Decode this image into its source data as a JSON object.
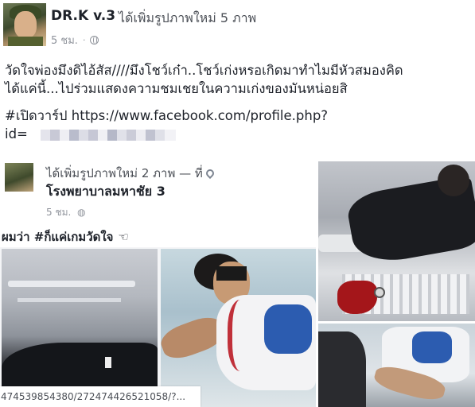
{
  "post": {
    "author": "DR.K v.3",
    "action": "ได้เพิ่มรูปภาพใหม่ 5 ภาพ",
    "time": "5 ชม.",
    "separator": "·",
    "privacy_icon": "globe-icon",
    "text_lines": [
      "วัดใจพ่องมึงดิไอ้สัส////มึงโชว์เก๋า..โชว์เก่งหรอเกิดมาทำไมมีหัวสมองคิด",
      "ได้แค่นี้...ไปร่วมแสดงความชมเชยในความเก่งของมันหน่อยสิ"
    ],
    "link_line": "#เปิดวาร์ป https://www.facebook.com/profile.php?",
    "id_label": "id="
  },
  "photos": {
    "shared_post": {
      "action": "ได้เพิ่มรูปภาพใหม่ 2 ภาพ — ที่",
      "location_icon": "map-pin-icon",
      "place": "โรงพยาบาลมหาชัย 3",
      "time": "5 ชม.",
      "caption": "ผมว่า #ก็แค่เกมวัดใจ",
      "hand_icon": "☜"
    },
    "url_overlay": "474539854380/272474426521058/?..."
  },
  "colors": {
    "text": "#1d2129",
    "secondary": "#90949c",
    "background": "#ffffff"
  }
}
